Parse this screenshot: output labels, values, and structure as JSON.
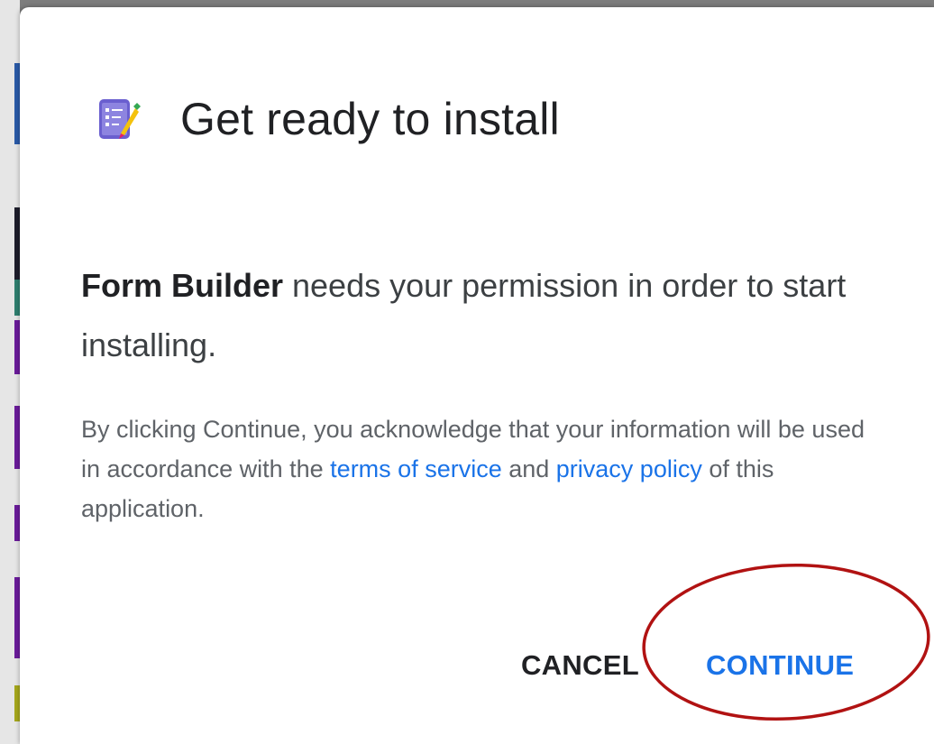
{
  "dialog": {
    "title": "Get ready to install",
    "app_icon": "form-builder-app-icon",
    "message": {
      "app_name": "Form Builder",
      "text": " needs your permission in order to start installing."
    },
    "disclaimer": {
      "part1": "By clicking Continue, you acknowledge that your information will be used in accordance with the ",
      "terms_link": "terms of service",
      "part2": " and ",
      "privacy_link": "privacy policy",
      "part3": " of this application."
    },
    "actions": {
      "cancel_label": "CANCEL",
      "continue_label": "CONTINUE"
    }
  },
  "colors": {
    "link": "#1a73e8",
    "primary_text": "#202124",
    "secondary_text": "#5f6368",
    "annotation_ring": "#b11212",
    "icon_purple": "#6a5fcf"
  }
}
